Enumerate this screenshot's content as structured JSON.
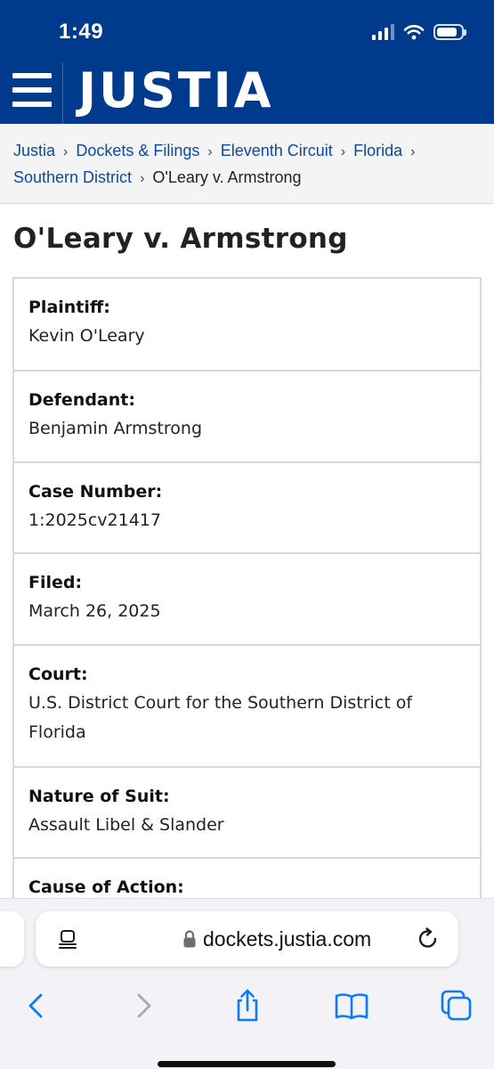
{
  "status_bar": {
    "time": "1:49",
    "battery_level": 0.85
  },
  "header": {
    "logo": "JUSTIA",
    "brand_color": "#003a8c",
    "menu_icon": "hamburger-menu-icon"
  },
  "breadcrumb": {
    "items": [
      "Justia",
      "Dockets & Filings",
      "Eleventh Circuit",
      "Florida",
      "Southern District"
    ],
    "current": "O'Leary v. Armstrong",
    "separator": "›"
  },
  "case": {
    "title": "O'Leary v. Armstrong",
    "fields": [
      {
        "label": "Plaintiff:",
        "value": "Kevin O'Leary"
      },
      {
        "label": "Defendant:",
        "value": "Benjamin Armstrong"
      },
      {
        "label": "Case Number:",
        "value": "1:2025cv21417"
      },
      {
        "label": "Filed:",
        "value": "March 26, 2025"
      },
      {
        "label": "Court:",
        "value": "U.S. District Court for the Southern District of Florida"
      },
      {
        "label": "Nature of Suit:",
        "value": "Assault Libel & Slander"
      },
      {
        "label": "Cause of Action:",
        "value": ""
      }
    ]
  },
  "browser": {
    "url": "dockets.justia.com",
    "accent_color": "#0a7aff",
    "toolbar_icons": [
      "back-icon",
      "forward-icon",
      "share-icon",
      "bookmarks-icon",
      "tabs-icon"
    ]
  }
}
